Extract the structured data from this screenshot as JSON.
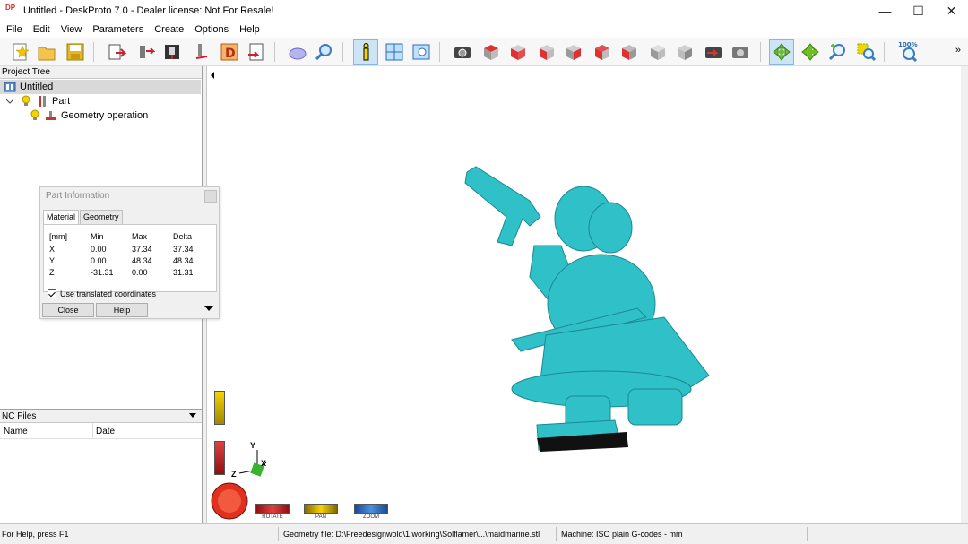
{
  "window": {
    "title": "Untitled - DeskProto 7.0 - Dealer license: Not For Resale!",
    "logo_text": "DP",
    "minimize_glyph": "—",
    "maximize_glyph": "☐",
    "close_glyph": "✕"
  },
  "menu": [
    "File",
    "Edit",
    "View",
    "Parameters",
    "Create",
    "Options",
    "Help"
  ],
  "toolbar": {
    "zoom_label": "100%",
    "more_glyph": "»",
    "icons": [
      "new-icon",
      "open-icon",
      "save-icon",
      "import-icon",
      "part-icon",
      "cnc-icon",
      "tool-icon",
      "d-icon",
      "export-icon",
      "3d-view-icon",
      "zoom-part-icon",
      "info-icon",
      "layout-icon",
      "preview-icon",
      "camera-icon",
      "view-top-icon",
      "view-front-icon",
      "view-left-icon",
      "view-right-icon",
      "view-back-icon",
      "view-bottom-icon",
      "view-iso-icon",
      "view-iso2-icon",
      "screenshot-icon",
      "screenshot2-icon",
      "rotate-mode-icon",
      "pan-mode-icon",
      "zoom-mode-icon",
      "zoom-window-icon",
      "zoom-100-icon"
    ]
  },
  "project_tree": {
    "header": "Project Tree",
    "items": [
      {
        "label": "Untitled",
        "level": 0
      },
      {
        "label": "Part",
        "level": 1
      },
      {
        "label": "Geometry operation",
        "level": 2
      }
    ]
  },
  "nc_files": {
    "header": "NC Files",
    "columns": [
      "Name",
      "Date"
    ]
  },
  "part_information": {
    "title": "Part Information",
    "tabs": [
      "Material",
      "Geometry"
    ],
    "active_tab": "Material",
    "headers": [
      "[mm]",
      "Min",
      "Max",
      "Delta"
    ],
    "rows": [
      [
        "X",
        "0.00",
        "37.34",
        "37.34"
      ],
      [
        "Y",
        "0.00",
        "48.34",
        "48.34"
      ],
      [
        "Z",
        "-31.31",
        "0.00",
        "31.31"
      ]
    ],
    "checkbox_label": "Use translated coordinates",
    "checkbox_checked": true,
    "close_label": "Close",
    "help_label": "Help"
  },
  "viewport": {
    "model_color": "#2fc0c8",
    "sliders": [
      "ROTATE",
      "PAN",
      "ZOOM"
    ],
    "axes": {
      "y": "Y",
      "z": "Z",
      "x": "X"
    }
  },
  "status": {
    "help": "For Help, press F1",
    "geometry_file": "Geometry file: D:\\Freedesignwold\\1.working\\Solflamer\\...\\maidmarine.stl",
    "machine": "Machine: ISO plain G-codes - mm"
  }
}
